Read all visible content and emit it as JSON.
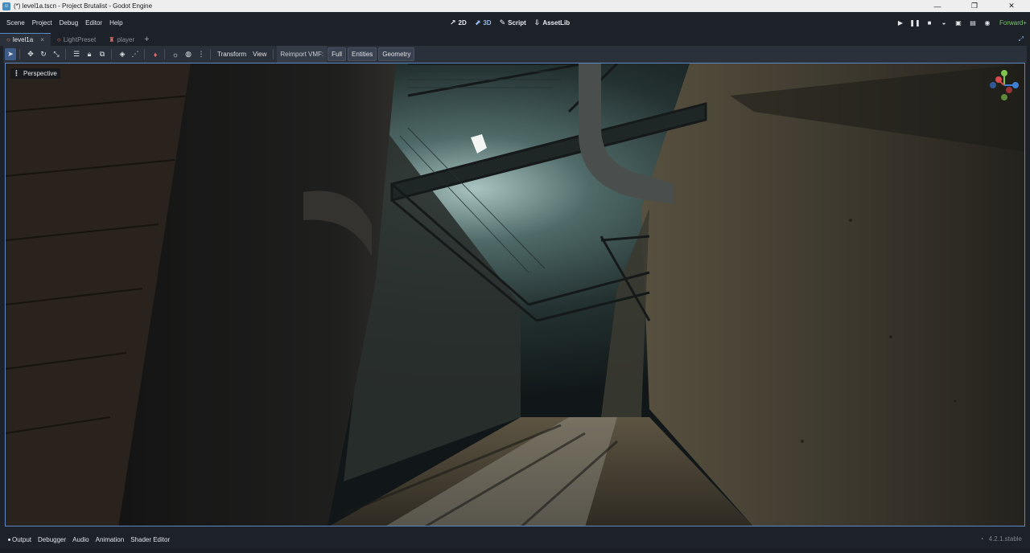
{
  "window": {
    "title": "(*) level1a.tscn - Project Brutalist - Godot Engine",
    "controls": {
      "minimize": "—",
      "maximize": "❐",
      "close": "✕"
    }
  },
  "menu": {
    "items": [
      "Scene",
      "Project",
      "Debug",
      "Editor",
      "Help"
    ]
  },
  "workspaces": [
    {
      "label": "2D",
      "icon": "2d-icon"
    },
    {
      "label": "3D",
      "icon": "3d-icon",
      "active": true
    },
    {
      "label": "Script",
      "icon": "script-icon"
    },
    {
      "label": "AssetLib",
      "icon": "assetlib-icon"
    }
  ],
  "run": {
    "renderer": "Forward+"
  },
  "tabs": [
    {
      "label": "level1a",
      "active": true
    },
    {
      "label": "LightPreset"
    },
    {
      "label": "player"
    }
  ],
  "toolbar": {
    "transform": "Transform",
    "view": "View",
    "reimport_label": "Reimport VMF:",
    "full": "Full",
    "entities": "Entities",
    "geometry": "Geometry"
  },
  "viewport": {
    "mode": "Perspective"
  },
  "bottom": {
    "tabs": [
      "Output",
      "Debugger",
      "Audio",
      "Animation",
      "Shader Editor"
    ],
    "version": "4.2.1.stable"
  },
  "colors": {
    "accent": "#5f87c6",
    "editor_bg": "#1d2229",
    "panel_bg": "#2b313a",
    "renderer_green": "#7cc46c"
  }
}
